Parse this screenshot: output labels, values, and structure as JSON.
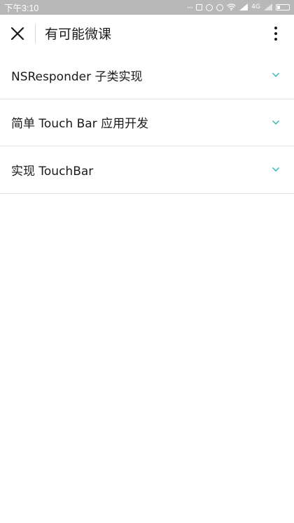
{
  "status_bar": {
    "time": "下午3:10",
    "icons": [
      "more-dots-icon",
      "copy-icon",
      "sync-icon",
      "alarm-icon",
      "wifi-icon",
      "signal-icon",
      "signal-icon",
      "battery-icon"
    ],
    "signal_label": "4G"
  },
  "header": {
    "title": "有可能微课",
    "close_icon": "close-icon",
    "more_icon": "more-vertical-icon"
  },
  "sections": [
    {
      "label": "NSResponder 子类实现",
      "icon": "chevron-down-icon"
    },
    {
      "label": "简单 Touch Bar 应用开发",
      "icon": "chevron-down-icon"
    },
    {
      "label": "实现 TouchBar",
      "icon": "chevron-down-icon"
    }
  ],
  "colors": {
    "status_bar_bg": "#b8b8b8",
    "accent_chevron": "#34b7b7",
    "divider": "#e3e3e3",
    "text": "#1a1a1a"
  }
}
